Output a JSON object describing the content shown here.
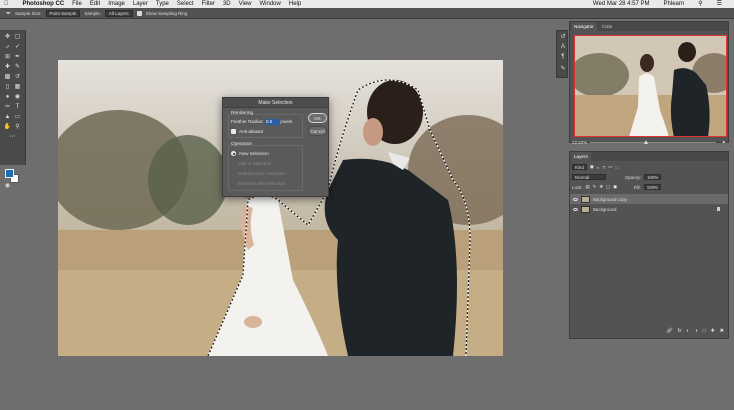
{
  "menubar": {
    "app_name": "Photoshop CC",
    "items": [
      "File",
      "Edit",
      "Image",
      "Layer",
      "Type",
      "Select",
      "Filter",
      "3D",
      "View",
      "Window",
      "Help"
    ],
    "clock": "Wed Mar 28  4:57 PM",
    "user": "Phlearn"
  },
  "options_bar": {
    "sample_size_label": "Sample Size:",
    "sample_size_value": "Point Sample",
    "sample_label": "Sample:",
    "sample_value": "All Layers",
    "show_ring_label": "Show Sampling Ring"
  },
  "colors": {
    "foreground": "#1f6fb0",
    "background": "#ffffff",
    "accent": "#2a5ea8",
    "navigator_frame": "#e03333"
  },
  "dialog": {
    "title": "Make Selection",
    "rendering_legend": "Rendering",
    "feather_label": "Feather Radius:",
    "feather_value": "0.5",
    "feather_unit": "pixels",
    "antialiased_label": "Anti-aliased",
    "operation_legend": "Operation",
    "op_new": "New Selection",
    "op_add": "Add to Selection",
    "op_subtract": "Subtract from Selection",
    "op_intersect": "Intersect with Selection",
    "ok_label": "OK",
    "cancel_label": "Cancel"
  },
  "navigator": {
    "tab_navigator": "Navigator",
    "tab_color": "Color",
    "zoom": "22.62%"
  },
  "layers": {
    "tab_label": "Layers",
    "kind_label": "Kind",
    "blend_mode": "Normal",
    "opacity_label": "Opacity:",
    "opacity_value": "100%",
    "lock_label": "Lock:",
    "fill_label": "Fill:",
    "fill_value": "100%",
    "items": [
      {
        "name": "Background copy",
        "selected": true
      },
      {
        "name": "Background",
        "selected": false
      }
    ]
  }
}
